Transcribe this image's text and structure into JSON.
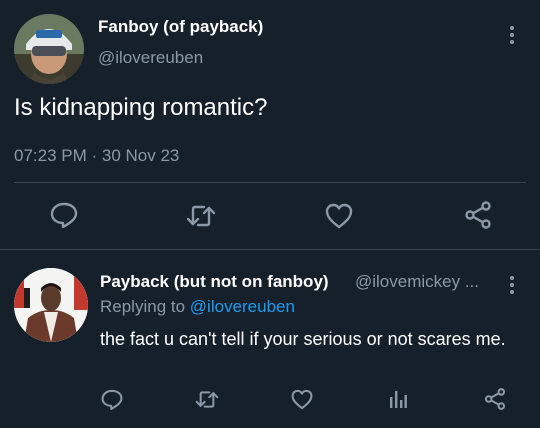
{
  "tweet": {
    "author_name": "Fanboy (of payback)",
    "author_handle": "@ilovereuben",
    "text": "Is kidnapping romantic?",
    "timestamp": "07:23 PM · 30 Nov 23",
    "actions": [
      "reply-icon",
      "retweet-icon",
      "like-icon",
      "share-icon"
    ]
  },
  "reply": {
    "author_name": "Payback (but not on fanboy)",
    "author_handle": "@ilovemickey ...",
    "replying_to_prefix": "Replying to",
    "replying_to_handle": "@ilovereuben",
    "text": "the fact u can't tell if your serious or not scares me.",
    "actions": [
      "reply-icon",
      "retweet-icon",
      "like-icon",
      "analytics-icon",
      "share-icon"
    ]
  },
  "colors": {
    "background": "#15202b",
    "text": "#ffffff",
    "muted": "#8b98a5",
    "accent": "#1d9bf0",
    "divider": "#38444d"
  }
}
